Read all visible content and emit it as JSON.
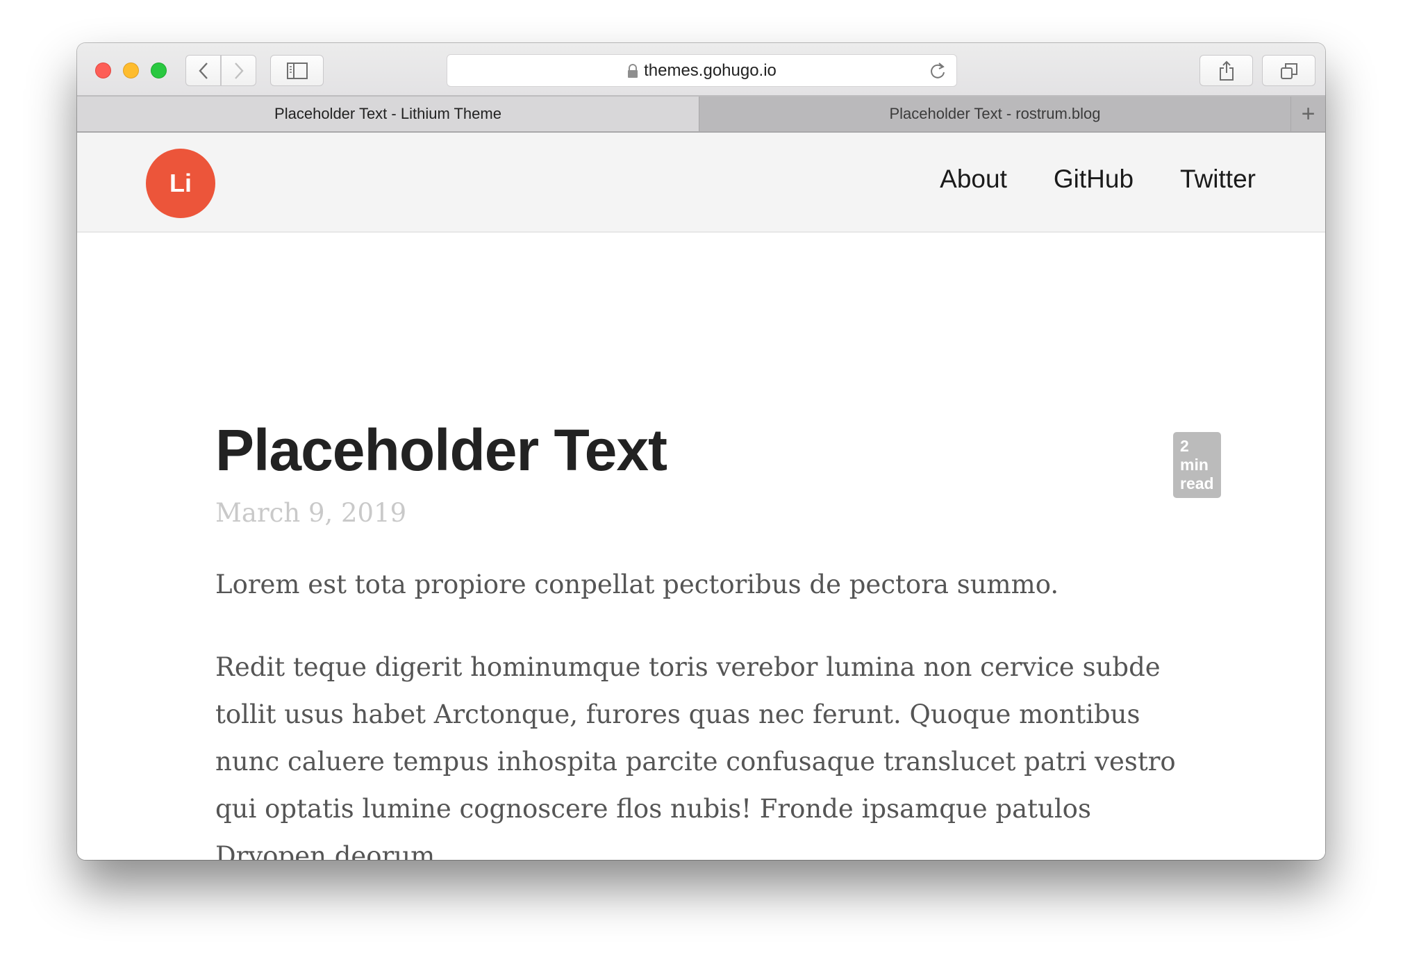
{
  "browser": {
    "url": "themes.gohugo.io",
    "tabs": [
      {
        "label": "Placeholder Text - Lithium Theme",
        "active": true
      },
      {
        "label": "Placeholder Text - rostrum.blog",
        "active": false
      }
    ],
    "new_tab_label": "+"
  },
  "site": {
    "logo_text": "Li",
    "brand_color": "#ec553a",
    "nav": [
      {
        "label": "About"
      },
      {
        "label": "GitHub"
      },
      {
        "label": "Twitter"
      }
    ]
  },
  "post": {
    "title": "Placeholder Text",
    "read_time": "2 min read",
    "date": "March 9, 2019",
    "paragraphs": [
      "Lorem est tota propiore conpellat pectoribus de pectora summo.",
      "Redit teque digerit hominumque toris verebor lumina non cervice subde tollit usus habet Arctonque, furores quas nec ferunt. Quoque montibus nunc caluere tempus inhospita parcite confusaque translucet patri vestro qui optatis lumine cognoscere flos nubis! Fronde ipsamque patulos Dryopen deorum."
    ]
  }
}
